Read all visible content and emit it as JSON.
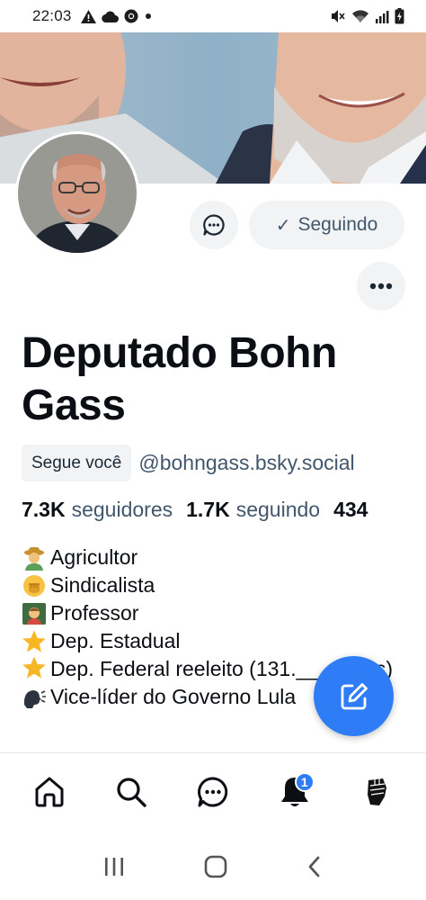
{
  "status_bar": {
    "time": "22:03",
    "left_icons": [
      "warning-icon",
      "cloud-icon",
      "chrome-icon",
      "dot-icon"
    ],
    "right_icons": [
      "mute-icon",
      "wifi-icon",
      "signal-icon",
      "battery-icon"
    ]
  },
  "profile": {
    "display_name": "Deputado Bohn Gass",
    "follows_you_label": "Segue você",
    "handle": "@bohngass.bsky.social",
    "follow_button_label": "Seguindo",
    "stats": {
      "followers_count": "7.3K",
      "followers_label": "seguidores",
      "following_count": "1.7K",
      "following_label": "seguindo",
      "posts_count": "434"
    },
    "bio_lines": [
      {
        "emoji": "farmer-emoji",
        "text": "Agricultor"
      },
      {
        "emoji": "fist-emoji",
        "text": "Sindicalista"
      },
      {
        "emoji": "teacher-emoji",
        "text": "Professor"
      },
      {
        "emoji": "star-emoji",
        "text": "Dep. Estadual"
      },
      {
        "emoji": "star-emoji",
        "text": "Dep. Federal reeleito (131.___ votos)"
      },
      {
        "emoji": "speaking-head-emoji",
        "text": "Vice-líder do Governo Lula"
      }
    ]
  },
  "bottom_nav": {
    "items": [
      "home-icon",
      "search-icon",
      "chat-icon",
      "notifications-icon",
      "profile-avatar"
    ],
    "notification_badge": "1"
  },
  "colors": {
    "accent": "#2f7df6",
    "secondary_text": "#42576c",
    "button_bg": "#f1f3f5"
  }
}
